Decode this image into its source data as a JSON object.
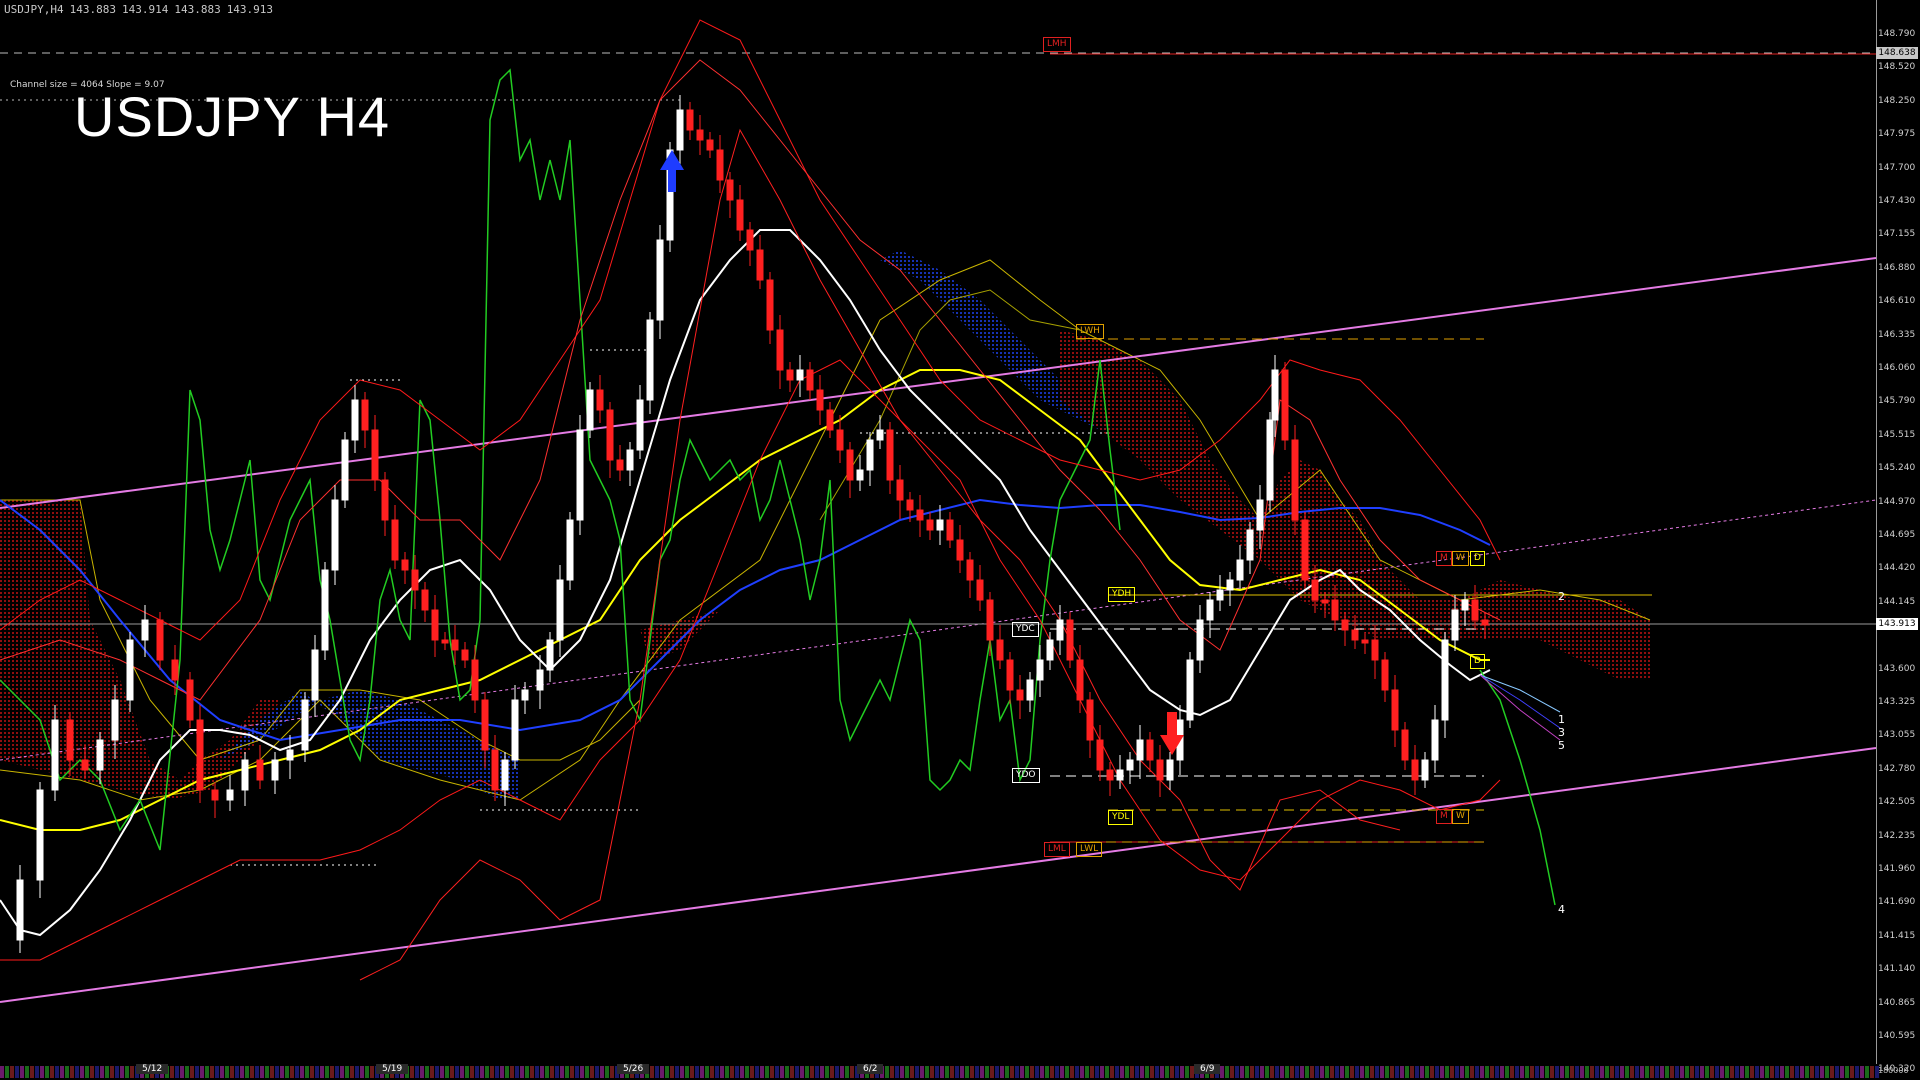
{
  "header": {
    "symbol_tf": "USDJPY,H4",
    "ohlc": [
      "143.883",
      "143.914",
      "143.883",
      "143.913"
    ]
  },
  "overlay_title": "USDJPY H4",
  "channel_info": "Channel size = 4064 Slope = 9.07",
  "price_scale": {
    "ticks": [
      "148.790",
      "148.520",
      "148.250",
      "147.975",
      "147.700",
      "147.430",
      "147.155",
      "146.880",
      "146.610",
      "146.335",
      "146.060",
      "145.790",
      "145.515",
      "145.240",
      "144.970",
      "144.695",
      "144.420",
      "144.145",
      "143.600",
      "143.325",
      "143.055",
      "142.780",
      "142.505",
      "142.235",
      "141.960",
      "141.690",
      "141.415",
      "141.140",
      "140.865",
      "140.595",
      "140.320"
    ],
    "top_marker": "148.638",
    "current_price": "143.913",
    "corner": "180000"
  },
  "time_axis": [
    "5/12",
    "5/19",
    "5/26",
    "6/2",
    "6/9"
  ],
  "levels": {
    "LMH": "LMH",
    "LWH": "LWH",
    "YDH": "YDH",
    "YDC": "YDC",
    "YDO": "YDO",
    "YDL": "YDL",
    "LML": "LML",
    "LWL": "LWL",
    "M1": "M",
    "W1": "W",
    "D1": "D",
    "D2": "D",
    "M2": "M",
    "W2": "W"
  },
  "projection_labels": [
    "2",
    "1",
    "3",
    "5",
    "4"
  ],
  "colors": {
    "background": "#000000",
    "bull": "#ffffff",
    "bear": "#ff2020",
    "channel": "#e47be4",
    "ma_white": "#ffffff",
    "ma_yellow": "#ffff00",
    "ma_blue": "#1f3fff",
    "osc_green": "#22cc22",
    "band_red": "#ff1a1a",
    "cloud_olive": "#c8b400",
    "cloud_red": "#b01010",
    "cloud_blue": "#1030b0"
  }
}
